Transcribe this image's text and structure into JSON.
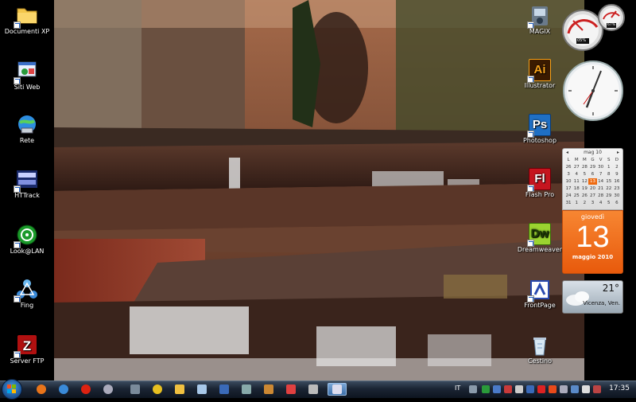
{
  "desktop": {
    "left_icons": [
      {
        "label": "Documenti XP",
        "icon": "folder-icon"
      },
      {
        "label": "Siti Web",
        "icon": "website-icon"
      },
      {
        "label": "Rete",
        "icon": "network-icon"
      },
      {
        "label": "HTTrack",
        "icon": "httrack-icon"
      },
      {
        "label": "Look@LAN",
        "icon": "lan-scanner-icon"
      },
      {
        "label": "Fing",
        "icon": "network-tool-icon"
      },
      {
        "label": "Server FTP",
        "icon": "filezilla-icon"
      }
    ],
    "right_icons": [
      {
        "label": "MAGIX",
        "icon": "magix-icon"
      },
      {
        "label": "Illustrator",
        "glyph": "Ai",
        "color": "#f7a21b",
        "bg": "#3a1a00"
      },
      {
        "label": "Photoshop",
        "glyph": "Ps",
        "color": "#ffffff",
        "bg": "#1f6fc4"
      },
      {
        "label": "Flash Pro",
        "glyph": "Fl",
        "color": "#ffffff",
        "bg": "#c5151f"
      },
      {
        "label": "Dreamweaver",
        "glyph": "Dw",
        "color": "#1f3d05",
        "bg": "#9bd430"
      },
      {
        "label": "FrontPage",
        "icon": "frontpage-icon"
      },
      {
        "label": "Cestino",
        "icon": "recycle-bin-icon"
      }
    ]
  },
  "gadgets": {
    "meter": {
      "cpu": "05%",
      "ram": "67%"
    },
    "calendar": {
      "header": "mag 10",
      "weekdays": [
        "L",
        "M",
        "M",
        "G",
        "V",
        "S",
        "D"
      ],
      "days": [
        "26",
        "27",
        "28",
        "29",
        "30",
        "1",
        "2",
        "3",
        "4",
        "5",
        "6",
        "7",
        "8",
        "9",
        "10",
        "11",
        "12",
        "13",
        "14",
        "15",
        "16",
        "17",
        "18",
        "19",
        "20",
        "21",
        "22",
        "23",
        "24",
        "25",
        "26",
        "27",
        "28",
        "29",
        "30",
        "31",
        "1",
        "2",
        "3",
        "4",
        "5",
        "6"
      ],
      "today_index": 17,
      "dow": "giovedì",
      "day": "13",
      "month_year": "maggio 2010"
    },
    "weather": {
      "temp": "21°",
      "location": "Vicenza, Ven."
    }
  },
  "taskbar": {
    "language": "IT",
    "time": "17:35"
  },
  "colors": {
    "accent_orange": "#ee6a10",
    "taskbar": "#1a2433"
  }
}
